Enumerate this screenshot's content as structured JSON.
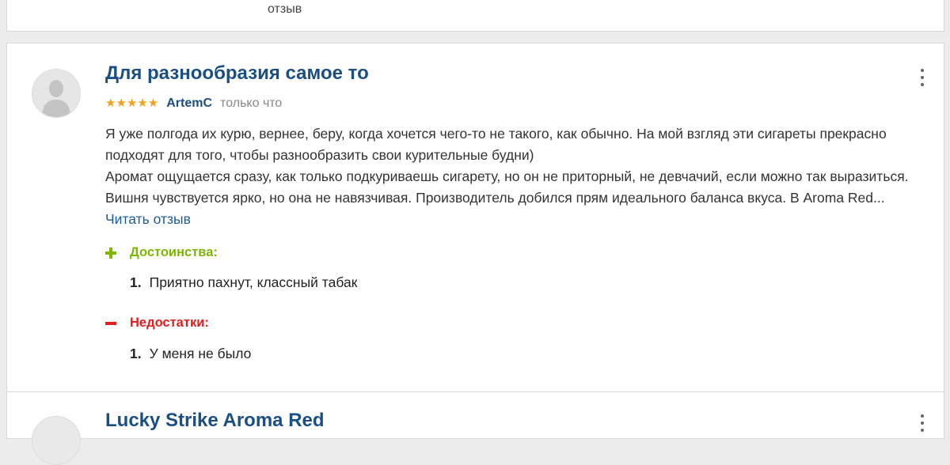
{
  "prev_card": {
    "read_label_fragment": "отзыв"
  },
  "review": {
    "title": "Для разнообразия самое то",
    "rating": 5,
    "stars": "★★★★★",
    "author": "ArtemC",
    "time": "только что",
    "text_line1": "Я уже полгода их курю, вернее, беру, когда хочется чего-то не такого, как обычно. На мой взгляд эти сигареты прекрасно подходят для того, чтобы разнообразить свои курительные будни)",
    "text_line2": "Аромат ощущается сразу, как только подкуриваешь сигарету, но он не приторный, не девчачий, если можно так выразиться. Вишня чувствуется ярко, но она не навязчивая. Производитель добился прям идеального баланса вкуса. В Aroma Red...",
    "read_more": "Читать отзыв",
    "pros_label": "Достоинства:",
    "pros": [
      {
        "num": "1.",
        "text": "Приятно пахнут, классный табак"
      }
    ],
    "cons_label": "Недостатки:",
    "cons": [
      {
        "num": "1.",
        "text": "У меня не было"
      }
    ]
  },
  "next_review": {
    "title": "Lucky Strike Aroma Red"
  },
  "colors": {
    "title": "#1a4f85",
    "stars": "#f4a11d",
    "pros": "#7cb800",
    "cons": "#e41e1e",
    "link": "#1a5d9a"
  }
}
